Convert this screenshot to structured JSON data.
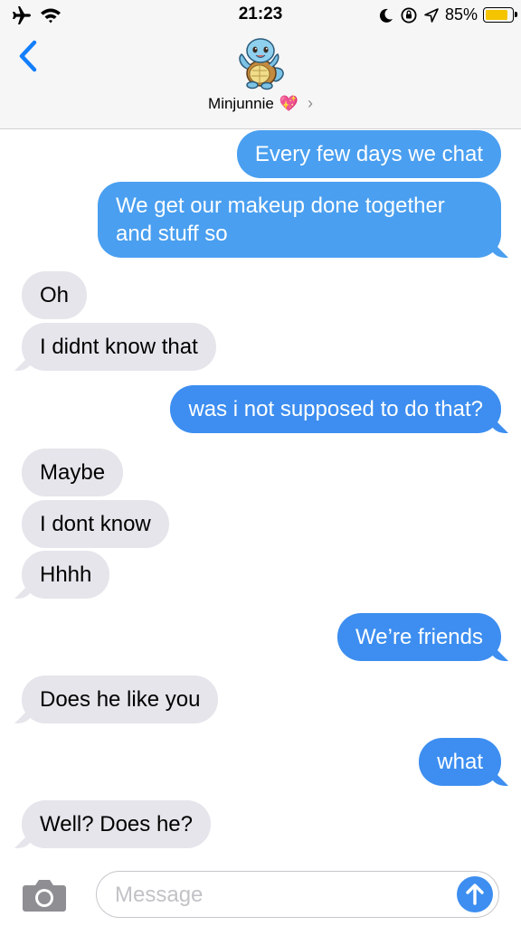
{
  "status_bar": {
    "time": "21:23",
    "battery_percent": "85%",
    "battery_level": 0.85
  },
  "header": {
    "contact_name": "Minjunnie",
    "contact_emoji": "💖",
    "chevron": "›"
  },
  "messages": [
    {
      "dir": "out",
      "text": "Every few days we chat"
    },
    {
      "dir": "out",
      "text": "We get our makeup done together",
      "text2": "and stuff so"
    },
    {
      "dir": "in",
      "text": "Oh"
    },
    {
      "dir": "in",
      "text": "I didnt know that"
    },
    {
      "dir": "out",
      "text": "was i not supposed to do that?"
    },
    {
      "dir": "in",
      "text": "Maybe"
    },
    {
      "dir": "in",
      "text": "I dont know"
    },
    {
      "dir": "in",
      "text": "Hhhh"
    },
    {
      "dir": "out",
      "text": "We’re friends"
    },
    {
      "dir": "in",
      "text": "Does he like you"
    },
    {
      "dir": "out",
      "text": "what"
    },
    {
      "dir": "in",
      "text": "Well? Does he?"
    }
  ],
  "input": {
    "placeholder": "Message"
  },
  "colors": {
    "outgoing_light": "#4a9ff0",
    "outgoing": "#3d8ef0",
    "incoming": "#e6e5eb",
    "ios_blue": "#147efb"
  }
}
